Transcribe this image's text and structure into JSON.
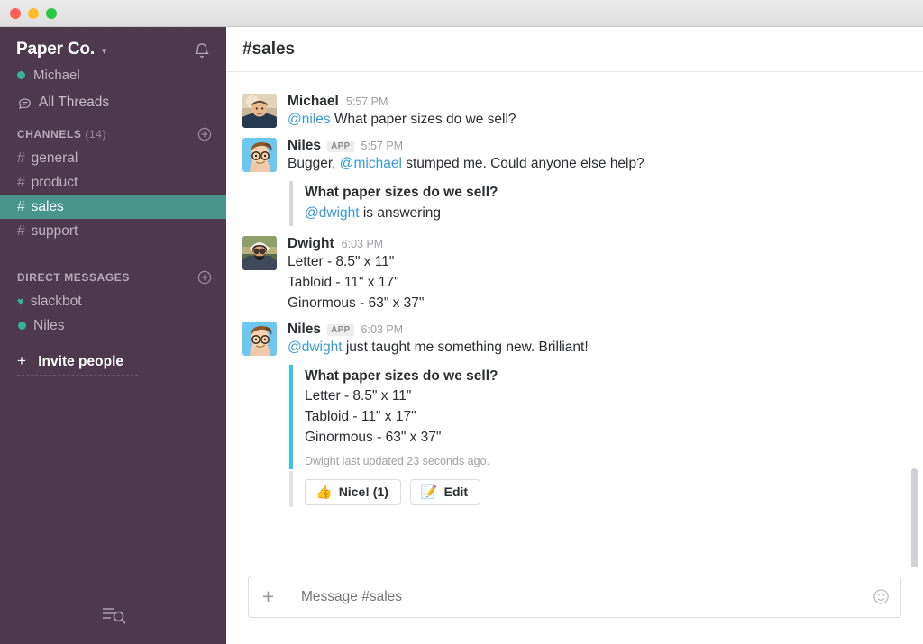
{
  "window": {
    "traffic_lights": [
      "close",
      "minimize",
      "maximize"
    ]
  },
  "sidebar": {
    "team_name": "Paper Co.",
    "team_caret_icon": "chevron-down-icon",
    "bell_icon": "bell-icon",
    "current_user": "Michael",
    "all_threads_label": "All Threads",
    "all_threads_icon": "threads-icon",
    "channels_section": {
      "label": "CHANNELS",
      "count": "(14)",
      "add_icon": "plus-circle-icon",
      "items": [
        {
          "name": "general",
          "prefix": "#",
          "active": false
        },
        {
          "name": "product",
          "prefix": "#",
          "active": false
        },
        {
          "name": "sales",
          "prefix": "#",
          "active": true
        },
        {
          "name": "support",
          "prefix": "#",
          "active": false
        }
      ]
    },
    "dm_section": {
      "label": "DIRECT MESSAGES",
      "add_icon": "plus-circle-icon",
      "items": [
        {
          "name": "slackbot",
          "marker": "heart"
        },
        {
          "name": "Niles",
          "marker": "online"
        }
      ]
    },
    "invite_label": "Invite people",
    "invite_prefix": "+",
    "bottom_icon": "search-list-icon",
    "colors": {
      "background": "#4d384c",
      "active_channel": "#49948b",
      "presence_green": "#38b196",
      "text": "#c2b4c1"
    }
  },
  "main": {
    "channel_title": "#sales",
    "messages": [
      {
        "id": "m1",
        "author": "Michael",
        "is_app": false,
        "time": "5:57 PM",
        "avatar": "michael-avatar",
        "text_parts": [
          {
            "type": "mention",
            "text": "@niles"
          },
          {
            "type": "plain",
            "text": " What paper sizes do we sell?"
          }
        ]
      },
      {
        "id": "m2",
        "author": "Niles",
        "is_app": true,
        "app_badge": "APP",
        "time": "5:57 PM",
        "avatar": "niles-avatar",
        "text_parts": [
          {
            "type": "plain",
            "text": "Bugger, "
          },
          {
            "type": "mention",
            "text": "@michael"
          },
          {
            "type": "plain",
            "text": " stumped me. Could anyone else help?"
          }
        ],
        "attachment": {
          "border_color": "#d8d8d8",
          "title": "What paper sizes do we sell?",
          "lines": [
            {
              "mention": "@dwight",
              "rest": " is answering"
            }
          ]
        }
      },
      {
        "id": "m3",
        "author": "Dwight",
        "is_app": false,
        "time": "6:03 PM",
        "avatar": "dwight-avatar",
        "lines": [
          "Letter - 8.5\" x 11\"",
          "Tabloid - 11\" x 17\"",
          "Ginormous - 63\" x 37\""
        ]
      },
      {
        "id": "m4",
        "author": "Niles",
        "is_app": true,
        "app_badge": "APP",
        "time": "6:03 PM",
        "avatar": "niles-avatar",
        "text_parts": [
          {
            "type": "mention",
            "text": "@dwight"
          },
          {
            "type": "plain",
            "text": " just taught me something new. Brilliant!"
          }
        ],
        "attachment": {
          "border_color": "#36c5f0",
          "title": "What paper sizes do we sell?",
          "lines": [
            "Letter - 8.5\" x 11\"",
            "Tabloid - 11\" x 17\"",
            "Ginormous - 63\" x 37\""
          ],
          "footer": "Dwight last updated 23 seconds ago."
        },
        "actions": [
          {
            "emoji": "👍",
            "label": "Nice! (1)",
            "name": "reaction-nice-button"
          },
          {
            "emoji": "📝",
            "label": "Edit",
            "name": "edit-button"
          }
        ]
      }
    ],
    "composer": {
      "add_icon": "plus-icon",
      "placeholder": "Message #sales",
      "value": "",
      "emoji_icon": "smiley-icon"
    },
    "scrollbar": "vertical-scrollbar"
  }
}
